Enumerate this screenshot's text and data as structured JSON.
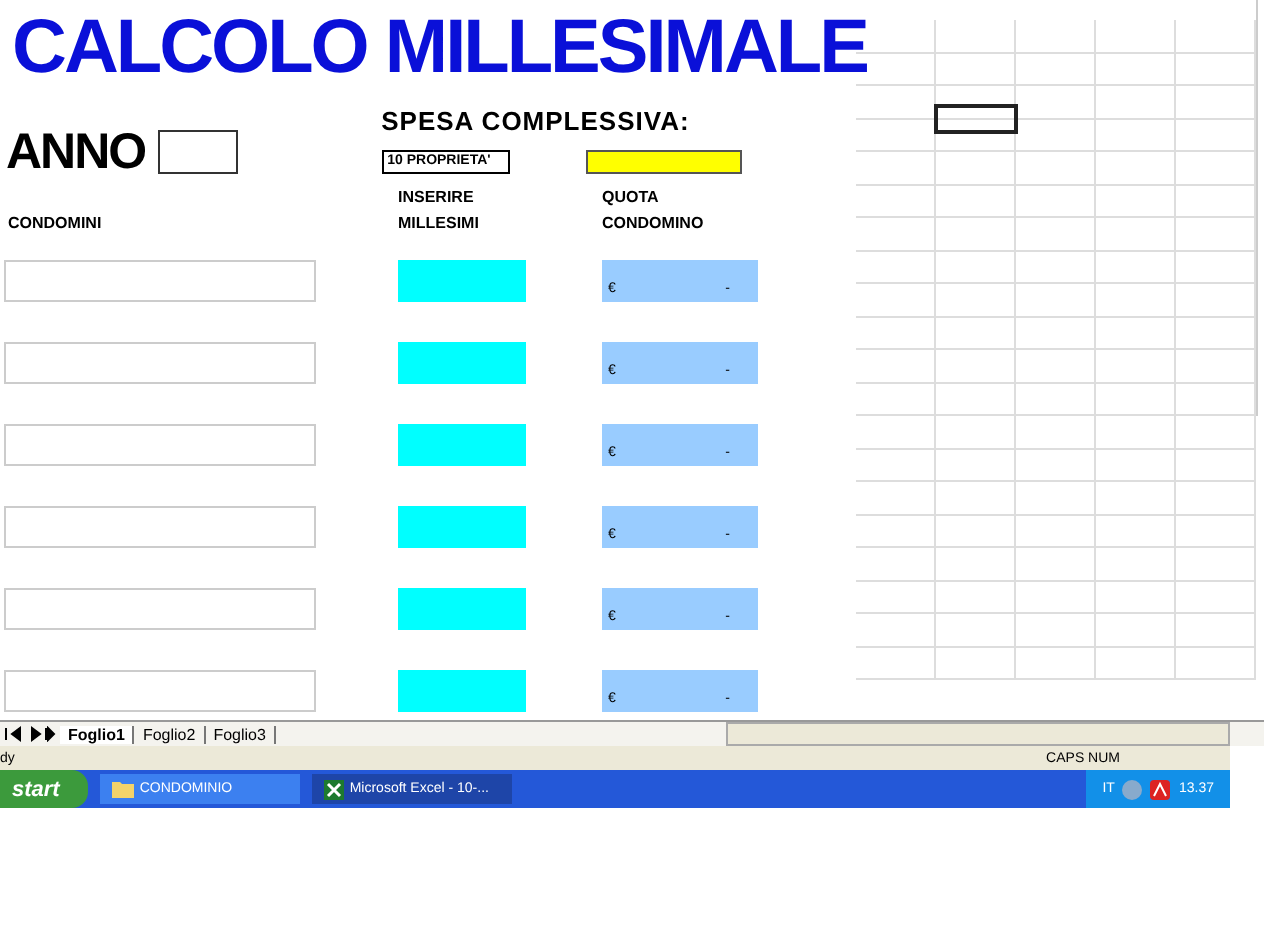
{
  "title": "CALCOLO MILLESIMALE",
  "anno": {
    "label": "ANNO"
  },
  "spesa": {
    "label": "SPESA COMPLESSIVA:",
    "note": "10 PROPRIETA'"
  },
  "headers": {
    "condomini": "CONDOMINI",
    "millesimi": "INSERIRE MILLESIMI",
    "quota": "QUOTA CONDOMINO"
  },
  "rows": [
    {
      "currency": "€",
      "value": "-"
    },
    {
      "currency": "€",
      "value": "-"
    },
    {
      "currency": "€",
      "value": "-"
    },
    {
      "currency": "€",
      "value": "-"
    },
    {
      "currency": "€",
      "value": "-"
    },
    {
      "currency": "€",
      "value": "-"
    }
  ],
  "sheet_tabs": [
    {
      "label": "Foglio1",
      "selected": true
    },
    {
      "label": "Foglio2",
      "selected": false
    },
    {
      "label": "Foglio3",
      "selected": false
    }
  ],
  "status_bar": {
    "left": "dy",
    "right": "CAPS NUM"
  },
  "taskbar": {
    "start": "start",
    "tasks": [
      {
        "label": "CONDOMINIO",
        "selected": false,
        "kind": "folder"
      },
      {
        "label": "Microsoft Excel - 10-...",
        "selected": true,
        "kind": "excel"
      }
    ],
    "language": "IT",
    "time": "13.37"
  }
}
